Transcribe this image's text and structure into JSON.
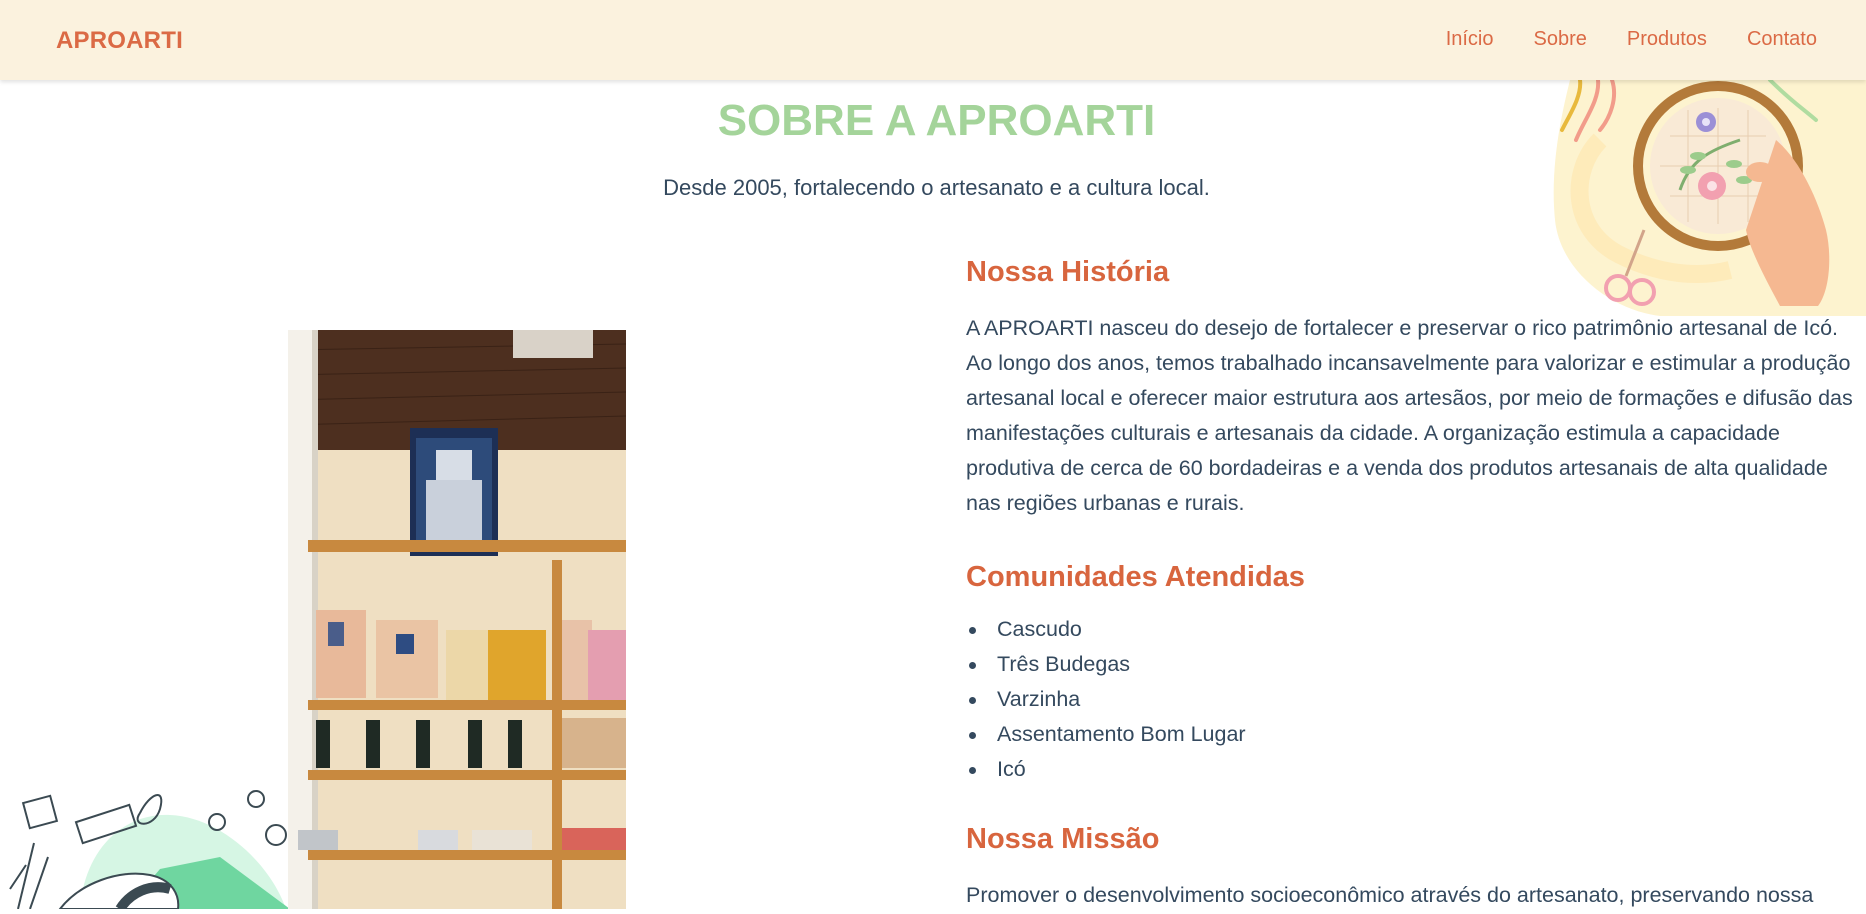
{
  "navbar": {
    "brand": "APROARTI",
    "links": [
      "Início",
      "Sobre",
      "Produtos",
      "Contato"
    ]
  },
  "hero": {
    "title": "SOBRE A APROARTI",
    "subtitle": "Desde 2005, fortalecendo o artesanato e a cultura local."
  },
  "history": {
    "heading": "Nossa História",
    "text": "A APROARTI nasceu do desejo de fortalecer e preservar o rico patrimônio artesanal de Icó. Ao longo dos anos, temos trabalhado incansavelmente para valorizar e estimular a produção artesanal local e oferecer maior estrutura aos artesãos, por meio de formações e difusão das manifestações culturais e artesanais da cidade. A organização estimula a capacidade produtiva de cerca de 60 bordadeiras e a venda dos produtos artesanais de alta qualidade nas regiões urbanas e rurais."
  },
  "communities": {
    "heading": "Comunidades Atendidas",
    "items": [
      "Cascudo",
      "Três Budegas",
      "Varzinha",
      "Assentamento Bom Lugar",
      "Icó"
    ]
  },
  "mission": {
    "heading": "Nossa Missão",
    "text": "Promover o desenvolvimento socioeconômico através do artesanato, preservando nossa"
  },
  "colors": {
    "navbar_bg": "#fbf2de",
    "accent": "#db6a45",
    "title_green": "#a4d49a",
    "text": "#34495e"
  },
  "icons": {
    "top_decoration": "embroidery-hoop-illustration",
    "bottom_decoration": "sewing-tools-illustration",
    "photo": "craft-store-shelves-photo"
  }
}
